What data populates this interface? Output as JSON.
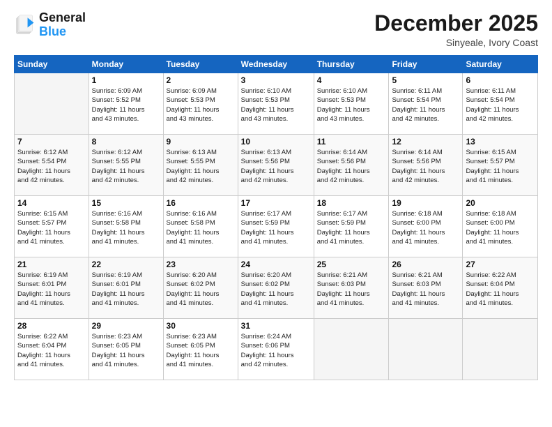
{
  "logo": {
    "general": "General",
    "blue": "Blue"
  },
  "title": "December 2025",
  "location": "Sinyeale, Ivory Coast",
  "weekdays": [
    "Sunday",
    "Monday",
    "Tuesday",
    "Wednesday",
    "Thursday",
    "Friday",
    "Saturday"
  ],
  "weeks": [
    [
      {
        "day": "",
        "info": ""
      },
      {
        "day": "1",
        "info": "Sunrise: 6:09 AM\nSunset: 5:52 PM\nDaylight: 11 hours\nand 43 minutes."
      },
      {
        "day": "2",
        "info": "Sunrise: 6:09 AM\nSunset: 5:53 PM\nDaylight: 11 hours\nand 43 minutes."
      },
      {
        "day": "3",
        "info": "Sunrise: 6:10 AM\nSunset: 5:53 PM\nDaylight: 11 hours\nand 43 minutes."
      },
      {
        "day": "4",
        "info": "Sunrise: 6:10 AM\nSunset: 5:53 PM\nDaylight: 11 hours\nand 43 minutes."
      },
      {
        "day": "5",
        "info": "Sunrise: 6:11 AM\nSunset: 5:54 PM\nDaylight: 11 hours\nand 42 minutes."
      },
      {
        "day": "6",
        "info": "Sunrise: 6:11 AM\nSunset: 5:54 PM\nDaylight: 11 hours\nand 42 minutes."
      }
    ],
    [
      {
        "day": "7",
        "info": "Sunrise: 6:12 AM\nSunset: 5:54 PM\nDaylight: 11 hours\nand 42 minutes."
      },
      {
        "day": "8",
        "info": "Sunrise: 6:12 AM\nSunset: 5:55 PM\nDaylight: 11 hours\nand 42 minutes."
      },
      {
        "day": "9",
        "info": "Sunrise: 6:13 AM\nSunset: 5:55 PM\nDaylight: 11 hours\nand 42 minutes."
      },
      {
        "day": "10",
        "info": "Sunrise: 6:13 AM\nSunset: 5:56 PM\nDaylight: 11 hours\nand 42 minutes."
      },
      {
        "day": "11",
        "info": "Sunrise: 6:14 AM\nSunset: 5:56 PM\nDaylight: 11 hours\nand 42 minutes."
      },
      {
        "day": "12",
        "info": "Sunrise: 6:14 AM\nSunset: 5:56 PM\nDaylight: 11 hours\nand 42 minutes."
      },
      {
        "day": "13",
        "info": "Sunrise: 6:15 AM\nSunset: 5:57 PM\nDaylight: 11 hours\nand 41 minutes."
      }
    ],
    [
      {
        "day": "14",
        "info": "Sunrise: 6:15 AM\nSunset: 5:57 PM\nDaylight: 11 hours\nand 41 minutes."
      },
      {
        "day": "15",
        "info": "Sunrise: 6:16 AM\nSunset: 5:58 PM\nDaylight: 11 hours\nand 41 minutes."
      },
      {
        "day": "16",
        "info": "Sunrise: 6:16 AM\nSunset: 5:58 PM\nDaylight: 11 hours\nand 41 minutes."
      },
      {
        "day": "17",
        "info": "Sunrise: 6:17 AM\nSunset: 5:59 PM\nDaylight: 11 hours\nand 41 minutes."
      },
      {
        "day": "18",
        "info": "Sunrise: 6:17 AM\nSunset: 5:59 PM\nDaylight: 11 hours\nand 41 minutes."
      },
      {
        "day": "19",
        "info": "Sunrise: 6:18 AM\nSunset: 6:00 PM\nDaylight: 11 hours\nand 41 minutes."
      },
      {
        "day": "20",
        "info": "Sunrise: 6:18 AM\nSunset: 6:00 PM\nDaylight: 11 hours\nand 41 minutes."
      }
    ],
    [
      {
        "day": "21",
        "info": "Sunrise: 6:19 AM\nSunset: 6:01 PM\nDaylight: 11 hours\nand 41 minutes."
      },
      {
        "day": "22",
        "info": "Sunrise: 6:19 AM\nSunset: 6:01 PM\nDaylight: 11 hours\nand 41 minutes."
      },
      {
        "day": "23",
        "info": "Sunrise: 6:20 AM\nSunset: 6:02 PM\nDaylight: 11 hours\nand 41 minutes."
      },
      {
        "day": "24",
        "info": "Sunrise: 6:20 AM\nSunset: 6:02 PM\nDaylight: 11 hours\nand 41 minutes."
      },
      {
        "day": "25",
        "info": "Sunrise: 6:21 AM\nSunset: 6:03 PM\nDaylight: 11 hours\nand 41 minutes."
      },
      {
        "day": "26",
        "info": "Sunrise: 6:21 AM\nSunset: 6:03 PM\nDaylight: 11 hours\nand 41 minutes."
      },
      {
        "day": "27",
        "info": "Sunrise: 6:22 AM\nSunset: 6:04 PM\nDaylight: 11 hours\nand 41 minutes."
      }
    ],
    [
      {
        "day": "28",
        "info": "Sunrise: 6:22 AM\nSunset: 6:04 PM\nDaylight: 11 hours\nand 41 minutes."
      },
      {
        "day": "29",
        "info": "Sunrise: 6:23 AM\nSunset: 6:05 PM\nDaylight: 11 hours\nand 41 minutes."
      },
      {
        "day": "30",
        "info": "Sunrise: 6:23 AM\nSunset: 6:05 PM\nDaylight: 11 hours\nand 41 minutes."
      },
      {
        "day": "31",
        "info": "Sunrise: 6:24 AM\nSunset: 6:06 PM\nDaylight: 11 hours\nand 42 minutes."
      },
      {
        "day": "",
        "info": ""
      },
      {
        "day": "",
        "info": ""
      },
      {
        "day": "",
        "info": ""
      }
    ]
  ]
}
